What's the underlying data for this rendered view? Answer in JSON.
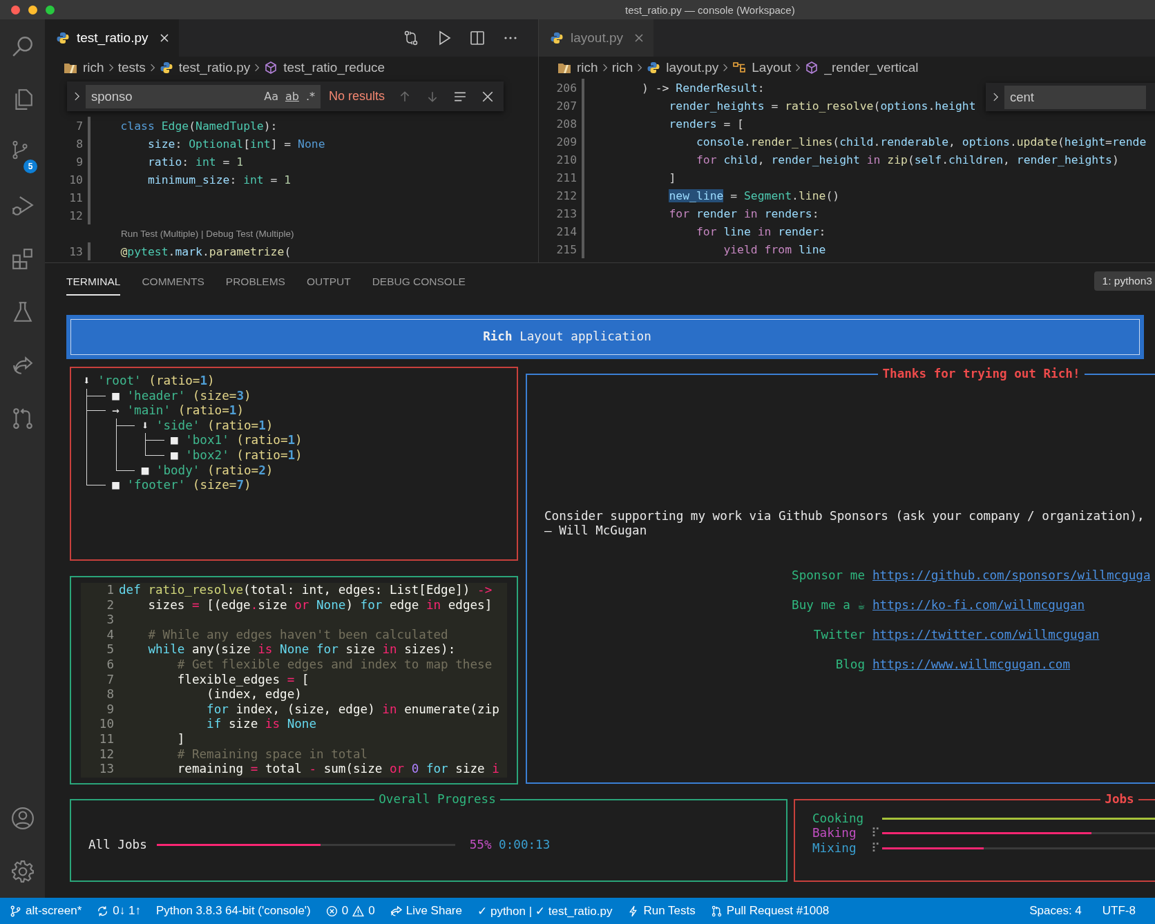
{
  "window": {
    "title": "test_ratio.py — console (Workspace)"
  },
  "activity_bar": {
    "badge": "5"
  },
  "editors": [
    {
      "tab": {
        "label": "test_ratio.py",
        "selected": true
      },
      "toolbar": true,
      "breadcrumb": [
        {
          "label": "rich",
          "kind": "folder"
        },
        {
          "label": "tests",
          "kind": "dir"
        },
        {
          "label": "test_ratio.py",
          "kind": "file"
        },
        {
          "label": "test_ratio_reduce",
          "kind": "method"
        }
      ],
      "find": {
        "value": "sponso",
        "toggles": [
          "Aa",
          "ab",
          ".*"
        ],
        "result": "No results"
      },
      "lines": [
        {
          "kind": "code",
          "number": "7",
          "tokens": [
            {
              "text": "    class",
              "kind": "kw"
            },
            {
              "text": " Edge",
              "kind": "type"
            },
            {
              "text": "(",
              "kind": "p"
            },
            {
              "text": "NamedTuple",
              "kind": "type"
            },
            {
              "text": "):",
              "kind": "p"
            }
          ]
        },
        {
          "kind": "code",
          "number": "8",
          "tokens": [
            {
              "text": "        size",
              "kind": "var"
            },
            {
              "text": ": ",
              "kind": "p"
            },
            {
              "text": "Optional",
              "kind": "type"
            },
            {
              "text": "[",
              "kind": "p"
            },
            {
              "text": "int",
              "kind": "type"
            },
            {
              "text": "] = ",
              "kind": "p"
            },
            {
              "text": "None",
              "kind": "kw"
            }
          ]
        },
        {
          "kind": "code",
          "number": "9",
          "tokens": [
            {
              "text": "        ratio",
              "kind": "var"
            },
            {
              "text": ": ",
              "kind": "p"
            },
            {
              "text": "int",
              "kind": "type"
            },
            {
              "text": " = ",
              "kind": "p"
            },
            {
              "text": "1",
              "kind": "num"
            }
          ]
        },
        {
          "kind": "code",
          "number": "10",
          "tokens": [
            {
              "text": "        minimum_size",
              "kind": "var"
            },
            {
              "text": ": ",
              "kind": "p"
            },
            {
              "text": "int",
              "kind": "type"
            },
            {
              "text": " = ",
              "kind": "p"
            },
            {
              "text": "1",
              "kind": "num"
            }
          ]
        },
        {
          "kind": "code",
          "number": "11"
        },
        {
          "kind": "code",
          "number": "12"
        },
        {
          "kind": "codelens",
          "text": "Run Test (Multiple) | Debug Test (Multiple)"
        },
        {
          "kind": "code",
          "number": "13",
          "tokens": [
            {
              "text": "    @",
              "kind": "fn"
            },
            {
              "text": "pytest",
              "kind": "type"
            },
            {
              "text": ".",
              "kind": "p"
            },
            {
              "text": "mark",
              "kind": "var"
            },
            {
              "text": ".",
              "kind": "p"
            },
            {
              "text": "parametrize",
              "kind": "fn"
            },
            {
              "text": "(",
              "kind": "p"
            }
          ]
        }
      ]
    },
    {
      "tab": {
        "label": "layout.py",
        "selected": false
      },
      "breadcrumb": [
        {
          "label": "rich",
          "kind": "folder"
        },
        {
          "label": "rich",
          "kind": "dir"
        },
        {
          "label": "layout.py",
          "kind": "file"
        },
        {
          "label": "Layout",
          "kind": "class"
        },
        {
          "label": "_render_vertical",
          "kind": "method"
        }
      ],
      "find": {
        "value": "cent"
      },
      "lines": [
        {
          "kind": "code",
          "number": "206",
          "tokens": [
            {
              "text": "        ) -> ",
              "kind": "p"
            },
            {
              "text": "RenderResult",
              "kind": "var"
            },
            {
              "text": ":",
              "kind": "p"
            }
          ]
        },
        {
          "kind": "code",
          "number": "207",
          "tokens": [
            {
              "text": "            render_heights",
              "kind": "var"
            },
            {
              "text": " = ",
              "kind": "p"
            },
            {
              "text": "ratio_resolve",
              "kind": "fn"
            },
            {
              "text": "(",
              "kind": "p"
            },
            {
              "text": "options",
              "kind": "var"
            },
            {
              "text": ".",
              "kind": "p"
            },
            {
              "text": "height",
              "kind": "var"
            }
          ]
        },
        {
          "kind": "code",
          "number": "208",
          "tokens": [
            {
              "text": "            renders",
              "kind": "var"
            },
            {
              "text": " = [",
              "kind": "p"
            }
          ]
        },
        {
          "kind": "code",
          "number": "209",
          "tokens": [
            {
              "text": "                console",
              "kind": "var"
            },
            {
              "text": ".",
              "kind": "p"
            },
            {
              "text": "render_lines",
              "kind": "fn"
            },
            {
              "text": "(",
              "kind": "p"
            },
            {
              "text": "child",
              "kind": "var"
            },
            {
              "text": ".",
              "kind": "p"
            },
            {
              "text": "renderable",
              "kind": "var"
            },
            {
              "text": ", ",
              "kind": "p"
            },
            {
              "text": "options",
              "kind": "var"
            },
            {
              "text": ".",
              "kind": "p"
            },
            {
              "text": "update",
              "kind": "fn"
            },
            {
              "text": "(",
              "kind": "p"
            },
            {
              "text": "height",
              "kind": "var"
            },
            {
              "text": "=",
              "kind": "p"
            },
            {
              "text": "rende",
              "kind": "var"
            }
          ]
        },
        {
          "kind": "code",
          "number": "210",
          "tokens": [
            {
              "text": "                for",
              "kind": "ctrl"
            },
            {
              "text": " child",
              "kind": "var"
            },
            {
              "text": ", ",
              "kind": "p"
            },
            {
              "text": "render_height",
              "kind": "var"
            },
            {
              "text": " in",
              "kind": "ctrl"
            },
            {
              "text": " zip",
              "kind": "fn"
            },
            {
              "text": "(",
              "kind": "p"
            },
            {
              "text": "self",
              "kind": "var"
            },
            {
              "text": ".",
              "kind": "p"
            },
            {
              "text": "children",
              "kind": "var"
            },
            {
              "text": ", ",
              "kind": "p"
            },
            {
              "text": "render_heights",
              "kind": "var"
            },
            {
              "text": ")",
              "kind": "p"
            }
          ]
        },
        {
          "kind": "code",
          "number": "211",
          "tokens": [
            {
              "text": "            ]",
              "kind": "p"
            }
          ]
        },
        {
          "kind": "code",
          "number": "212",
          "tokens": [
            {
              "text": "            new_line",
              "kind": "highlight"
            },
            {
              "text": " = ",
              "kind": "p"
            },
            {
              "text": "Segment",
              "kind": "type"
            },
            {
              "text": ".",
              "kind": "p"
            },
            {
              "text": "line",
              "kind": "fn"
            },
            {
              "text": "()",
              "kind": "p"
            }
          ]
        },
        {
          "kind": "code",
          "number": "213",
          "tokens": [
            {
              "text": "            for",
              "kind": "ctrl"
            },
            {
              "text": " render",
              "kind": "var"
            },
            {
              "text": " in",
              "kind": "ctrl"
            },
            {
              "text": " renders",
              "kind": "var"
            },
            {
              "text": ":",
              "kind": "p"
            }
          ]
        },
        {
          "kind": "code",
          "number": "214",
          "tokens": [
            {
              "text": "                for",
              "kind": "ctrl"
            },
            {
              "text": " line",
              "kind": "var"
            },
            {
              "text": " in",
              "kind": "ctrl"
            },
            {
              "text": " render",
              "kind": "var"
            },
            {
              "text": ":",
              "kind": "p"
            }
          ]
        },
        {
          "kind": "code",
          "number": "215",
          "tokens": [
            {
              "text": "                    yield",
              "kind": "ctrl"
            },
            {
              "text": " from",
              "kind": "ctrl"
            },
            {
              "text": " line",
              "kind": "var"
            }
          ]
        }
      ]
    }
  ],
  "panel": {
    "tabs": [
      {
        "label": "TERMINAL",
        "selected": true
      },
      {
        "label": "COMMENTS",
        "selected": false
      },
      {
        "label": "PROBLEMS",
        "selected": false
      },
      {
        "label": "OUTPUT",
        "selected": false
      },
      {
        "label": "DEBUG CONSOLE",
        "selected": false
      }
    ],
    "terminal_selector": "1: python3"
  },
  "terminal": {
    "header": "**Rich** Layout application",
    "tree": [
      {
        "icon": "⬇",
        "name": "'root'",
        "spec": [
          {
            "text": "(ratio=",
            "kind": "paren"
          },
          {
            "text": "1",
            "kind": "num"
          },
          {
            "text": ")",
            "kind": "paren"
          }
        ],
        "children": [
          {
            "icon": "■",
            "name": "'header'",
            "spec": [
              {
                "text": "(size=",
                "kind": "paren"
              },
              {
                "text": "3",
                "kind": "num"
              },
              {
                "text": ")",
                "kind": "paren"
              }
            ]
          },
          {
            "icon": "→",
            "name": "'main'",
            "spec": [
              {
                "text": "(ratio=",
                "kind": "paren"
              },
              {
                "text": "1",
                "kind": "num"
              },
              {
                "text": ")",
                "kind": "paren"
              }
            ],
            "children": [
              {
                "icon": "⬇",
                "name": "'side'",
                "spec": [
                  {
                    "text": "(ratio=",
                    "kind": "paren"
                  },
                  {
                    "text": "1",
                    "kind": "num"
                  },
                  {
                    "text": ")",
                    "kind": "paren"
                  }
                ],
                "children": [
                  {
                    "icon": "■",
                    "name": "'box1'",
                    "spec": [
                      {
                        "text": "(ratio=",
                        "kind": "paren"
                      },
                      {
                        "text": "1",
                        "kind": "num"
                      },
                      {
                        "text": ")",
                        "kind": "paren"
                      }
                    ]
                  },
                  {
                    "icon": "■",
                    "name": "'box2'",
                    "spec": [
                      {
                        "text": "(ratio=",
                        "kind": "paren"
                      },
                      {
                        "text": "1",
                        "kind": "num"
                      },
                      {
                        "text": ")",
                        "kind": "paren"
                      }
                    ]
                  }
                ]
              },
              {
                "icon": "■",
                "name": "'body'",
                "spec": [
                  {
                    "text": "(ratio=",
                    "kind": "paren"
                  },
                  {
                    "text": "2",
                    "kind": "num"
                  },
                  {
                    "text": ")",
                    "kind": "paren"
                  }
                ]
              }
            ]
          },
          {
            "icon": "■",
            "name": "'footer'",
            "spec": [
              {
                "text": "(size=",
                "kind": "paren"
              },
              {
                "text": "7",
                "kind": "num"
              },
              {
                "text": ")",
                "kind": "paren"
              }
            ]
          }
        ]
      }
    ],
    "code": [
      {
        "number": "1",
        "tokens": [
          {
            "text": "def",
            "kind": "mk"
          },
          {
            "text": " ratio_resolve",
            "kind": "mf"
          },
          {
            "text": "(total: int, edges: List[Edge]) ",
            "kind": "mp"
          },
          {
            "text": "->",
            "kind": "mo"
          }
        ]
      },
      {
        "number": "2",
        "tokens": [
          {
            "text": "    sizes ",
            "kind": "mp"
          },
          {
            "text": "=",
            "kind": "mo"
          },
          {
            "text": " [(edge",
            "kind": "mp"
          },
          {
            "text": ".",
            "kind": "mo"
          },
          {
            "text": "size ",
            "kind": "mp"
          },
          {
            "text": "or",
            "kind": "mo"
          },
          {
            "text": " None",
            "kind": "mk"
          },
          {
            "text": ") ",
            "kind": "mp"
          },
          {
            "text": "for",
            "kind": "mk"
          },
          {
            "text": " edge ",
            "kind": "mp"
          },
          {
            "text": "in",
            "kind": "mo"
          },
          {
            "text": " edges]",
            "kind": "mp"
          }
        ]
      },
      {
        "number": "3"
      },
      {
        "number": "4",
        "tokens": [
          {
            "text": "    # While any edges haven't been calculated",
            "kind": "mc"
          }
        ]
      },
      {
        "number": "5",
        "tokens": [
          {
            "text": "    while",
            "kind": "mk"
          },
          {
            "text": " any(size ",
            "kind": "mp"
          },
          {
            "text": "is",
            "kind": "mo"
          },
          {
            "text": " None",
            "kind": "mk"
          },
          {
            "text": " for",
            "kind": "mk"
          },
          {
            "text": " size ",
            "kind": "mp"
          },
          {
            "text": "in",
            "kind": "mo"
          },
          {
            "text": " sizes):",
            "kind": "mp"
          }
        ]
      },
      {
        "number": "6",
        "tokens": [
          {
            "text": "        # Get flexible edges and index to map these",
            "kind": "mc"
          }
        ]
      },
      {
        "number": "7",
        "tokens": [
          {
            "text": "        flexible_edges ",
            "kind": "mp"
          },
          {
            "text": "=",
            "kind": "mo"
          },
          {
            "text": " [",
            "kind": "mp"
          }
        ]
      },
      {
        "number": "8",
        "tokens": [
          {
            "text": "            (index, edge)",
            "kind": "mp"
          }
        ]
      },
      {
        "number": "9",
        "tokens": [
          {
            "text": "            for",
            "kind": "mk"
          },
          {
            "text": " index, (size, edge) ",
            "kind": "mp"
          },
          {
            "text": "in",
            "kind": "mo"
          },
          {
            "text": " enumerate(zip",
            "kind": "mp"
          }
        ]
      },
      {
        "number": "10",
        "tokens": [
          {
            "text": "            if",
            "kind": "mk"
          },
          {
            "text": " size ",
            "kind": "mp"
          },
          {
            "text": "is",
            "kind": "mo"
          },
          {
            "text": " None",
            "kind": "mk"
          }
        ]
      },
      {
        "number": "11",
        "tokens": [
          {
            "text": "        ]",
            "kind": "mp"
          }
        ]
      },
      {
        "number": "12",
        "tokens": [
          {
            "text": "        # Remaining space in total",
            "kind": "mc"
          }
        ]
      },
      {
        "number": "13",
        "tokens": [
          {
            "text": "        remaining ",
            "kind": "mp"
          },
          {
            "text": "=",
            "kind": "mo"
          },
          {
            "text": " total ",
            "kind": "mp"
          },
          {
            "text": "-",
            "kind": "mo"
          },
          {
            "text": " sum(size ",
            "kind": "mp"
          },
          {
            "text": "or",
            "kind": "mo"
          },
          {
            "text": " 0",
            "kind": "mn"
          },
          {
            "text": " for",
            "kind": "mk"
          },
          {
            "text": " size ",
            "kind": "mp"
          },
          {
            "text": "i",
            "kind": "mo"
          }
        ]
      }
    ],
    "message": {
      "title": "Thanks for trying out Rich!",
      "lines": [
        "Consider supporting my work via Github Sponsors (ask your company / organization),",
        "– Will McGugan"
      ],
      "links": [
        {
          "label": "Sponsor me",
          "url": "https://github.com/sponsors/willmcguga"
        },
        {
          "label": "Buy me a ☕",
          "url": "https://ko-fi.com/willmcgugan"
        },
        {
          "label": "Twitter",
          "url": "https://twitter.com/willmcgugan"
        },
        {
          "label": "Blog",
          "url": "https://www.willmcgugan.com"
        }
      ]
    },
    "progress": {
      "title": "Overall Progress",
      "label": "All Jobs",
      "level": 0.55,
      "percent": "55%",
      "elapsed": "0:00:13"
    },
    "jobs": {
      "title": "Jobs",
      "items": [
        {
          "label": "Cooking",
          "color": "#2fb87f",
          "level": 1
        },
        {
          "label": "Baking",
          "color": "#c24fc2",
          "spinner": "⠏",
          "level": 0.72
        },
        {
          "label": "Mixing",
          "color": "#3a9fd0",
          "spinner": "⠏",
          "level": 0.35
        }
      ]
    }
  },
  "status_bar": {
    "left": [
      {
        "kind": "branch",
        "text": "alt-screen*"
      },
      {
        "kind": "sync",
        "text": "0↓ 1↑"
      },
      {
        "kind": "plain",
        "text": "Python 3.8.3 64-bit ('console')"
      },
      {
        "kind": "problems",
        "errors": "0",
        "warnings": "0"
      },
      {
        "kind": "liveshare",
        "text": "Live Share"
      },
      {
        "kind": "plain",
        "text": "✓ python | ✓ test_ratio.py"
      },
      {
        "kind": "bolt",
        "text": "Run Tests"
      },
      {
        "kind": "pull",
        "text": "Pull Request #1008"
      }
    ],
    "right": [
      "Spaces: 4",
      "UTF-8"
    ]
  }
}
